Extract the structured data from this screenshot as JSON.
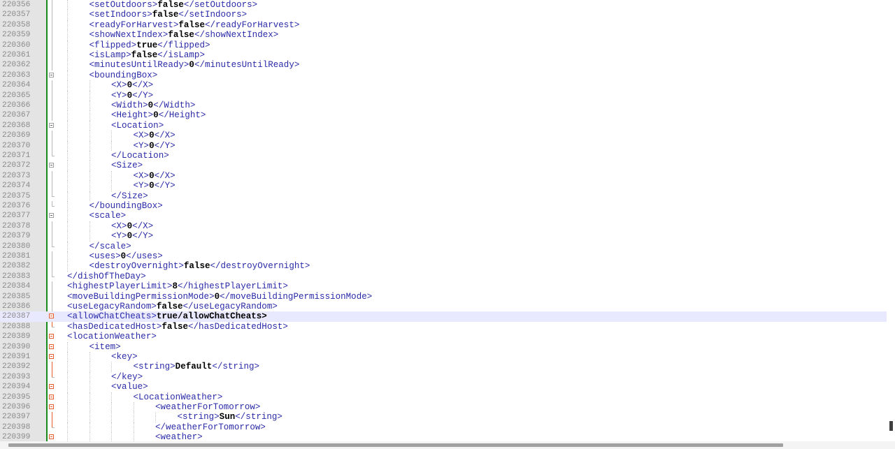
{
  "editor": {
    "current_line": "220387",
    "lines": [
      {
        "num": "220356",
        "indent": 2,
        "fold": "line",
        "open": "<setOutdoors>",
        "value": "false",
        "close": "</setOutdoors>"
      },
      {
        "num": "220357",
        "indent": 2,
        "fold": "line",
        "open": "<setIndoors>",
        "value": "false",
        "close": "</setIndoors>"
      },
      {
        "num": "220358",
        "indent": 2,
        "fold": "line",
        "open": "<readyForHarvest>",
        "value": "false",
        "close": "</readyForHarvest>"
      },
      {
        "num": "220359",
        "indent": 2,
        "fold": "line",
        "open": "<showNextIndex>",
        "value": "false",
        "close": "</showNextIndex>"
      },
      {
        "num": "220360",
        "indent": 2,
        "fold": "line",
        "open": "<flipped>",
        "value": "true",
        "close": "</flipped>"
      },
      {
        "num": "220361",
        "indent": 2,
        "fold": "line",
        "open": "<isLamp>",
        "value": "false",
        "close": "</isLamp>"
      },
      {
        "num": "220362",
        "indent": 2,
        "fold": "line",
        "open": "<minutesUntilReady>",
        "value": "0",
        "close": "</minutesUntilReady>"
      },
      {
        "num": "220363",
        "indent": 2,
        "fold": "box",
        "open": "<boundingBox>",
        "value": "",
        "close": ""
      },
      {
        "num": "220364",
        "indent": 3,
        "fold": "line",
        "open": "<X>",
        "value": "0",
        "close": "</X>"
      },
      {
        "num": "220365",
        "indent": 3,
        "fold": "line",
        "open": "<Y>",
        "value": "0",
        "close": "</Y>"
      },
      {
        "num": "220366",
        "indent": 3,
        "fold": "line",
        "open": "<Width>",
        "value": "0",
        "close": "</Width>"
      },
      {
        "num": "220367",
        "indent": 3,
        "fold": "line",
        "open": "<Height>",
        "value": "0",
        "close": "</Height>"
      },
      {
        "num": "220368",
        "indent": 3,
        "fold": "box",
        "open": "<Location>",
        "value": "",
        "close": ""
      },
      {
        "num": "220369",
        "indent": 4,
        "fold": "line",
        "open": "<X>",
        "value": "0",
        "close": "</X>"
      },
      {
        "num": "220370",
        "indent": 4,
        "fold": "line",
        "open": "<Y>",
        "value": "0",
        "close": "</Y>"
      },
      {
        "num": "220371",
        "indent": 3,
        "fold": "end",
        "open": "</Location>",
        "value": "",
        "close": ""
      },
      {
        "num": "220372",
        "indent": 3,
        "fold": "box",
        "open": "<Size>",
        "value": "",
        "close": ""
      },
      {
        "num": "220373",
        "indent": 4,
        "fold": "line",
        "open": "<X>",
        "value": "0",
        "close": "</X>"
      },
      {
        "num": "220374",
        "indent": 4,
        "fold": "line",
        "open": "<Y>",
        "value": "0",
        "close": "</Y>"
      },
      {
        "num": "220375",
        "indent": 3,
        "fold": "end",
        "open": "</Size>",
        "value": "",
        "close": ""
      },
      {
        "num": "220376",
        "indent": 2,
        "fold": "end",
        "open": "</boundingBox>",
        "value": "",
        "close": ""
      },
      {
        "num": "220377",
        "indent": 2,
        "fold": "box",
        "open": "<scale>",
        "value": "",
        "close": ""
      },
      {
        "num": "220378",
        "indent": 3,
        "fold": "line",
        "open": "<X>",
        "value": "0",
        "close": "</X>"
      },
      {
        "num": "220379",
        "indent": 3,
        "fold": "line",
        "open": "<Y>",
        "value": "0",
        "close": "</Y>"
      },
      {
        "num": "220380",
        "indent": 2,
        "fold": "end",
        "open": "</scale>",
        "value": "",
        "close": ""
      },
      {
        "num": "220381",
        "indent": 2,
        "fold": "line",
        "open": "<uses>",
        "value": "0",
        "close": "</uses>"
      },
      {
        "num": "220382",
        "indent": 2,
        "fold": "line",
        "open": "<destroyOvernight>",
        "value": "false",
        "close": "</destroyOvernight>"
      },
      {
        "num": "220383",
        "indent": 1,
        "fold": "end",
        "open": "</dishOfTheDay>",
        "value": "",
        "close": ""
      },
      {
        "num": "220384",
        "indent": 1,
        "fold": "line",
        "open": "<highestPlayerLimit>",
        "value": "8",
        "close": "</highestPlayerLimit>"
      },
      {
        "num": "220385",
        "indent": 1,
        "fold": "line",
        "open": "<moveBuildingPermissionMode>",
        "value": "0",
        "close": "</moveBuildingPermissionMode>"
      },
      {
        "num": "220386",
        "indent": 1,
        "fold": "line",
        "open": "<useLegacyRandom>",
        "value": "false",
        "close": "</useLegacyRandom>"
      },
      {
        "num": "220387",
        "indent": 1,
        "fold": "box",
        "open": "<allowChatCheats>",
        "value": "true/allowChatCheats>",
        "close": "",
        "current": true
      },
      {
        "num": "220388",
        "indent": 1,
        "fold": "end",
        "open": "<hasDedicatedHost>",
        "value": "false",
        "close": "</hasDedicatedHost>",
        "current_fold": true
      },
      {
        "num": "220389",
        "indent": 1,
        "fold": "box",
        "open": "<locationWeather>",
        "value": "",
        "close": "",
        "current_fold": true
      },
      {
        "num": "220390",
        "indent": 2,
        "fold": "box",
        "open": "<item>",
        "value": "",
        "close": "",
        "current_fold": true
      },
      {
        "num": "220391",
        "indent": 3,
        "fold": "box",
        "open": "<key>",
        "value": "",
        "close": "",
        "current_fold": true
      },
      {
        "num": "220392",
        "indent": 4,
        "fold": "line",
        "open": "<string>",
        "value": "Default",
        "close": "</string>",
        "current_fold": true
      },
      {
        "num": "220393",
        "indent": 3,
        "fold": "end",
        "open": "</key>",
        "value": "",
        "close": "",
        "current_fold": true
      },
      {
        "num": "220394",
        "indent": 3,
        "fold": "box",
        "open": "<value>",
        "value": "",
        "close": "",
        "current_fold": true
      },
      {
        "num": "220395",
        "indent": 4,
        "fold": "box",
        "open": "<LocationWeather>",
        "value": "",
        "close": "",
        "current_fold": true
      },
      {
        "num": "220396",
        "indent": 5,
        "fold": "box",
        "open": "<weatherForTomorrow>",
        "value": "",
        "close": "",
        "current_fold": true
      },
      {
        "num": "220397",
        "indent": 6,
        "fold": "line",
        "open": "<string>",
        "value": "Sun",
        "close": "</string>",
        "current_fold": true
      },
      {
        "num": "220398",
        "indent": 5,
        "fold": "end",
        "open": "</weatherForTomorrow>",
        "value": "",
        "close": "",
        "current_fold": true
      },
      {
        "num": "220399",
        "indent": 5,
        "fold": "box",
        "open": "<weather>",
        "value": "",
        "close": "",
        "current_fold": true
      }
    ]
  },
  "colors": {
    "tag": "#2a2aa8",
    "value": "#000000",
    "current_line": "#e8e8ff",
    "change_bar": "#1a8a1a",
    "fold_active": "#e85c2c"
  }
}
